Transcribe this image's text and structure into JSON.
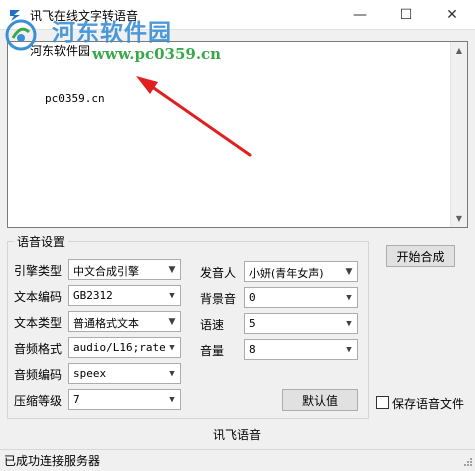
{
  "window": {
    "title": "讯飞在线文字转语音",
    "minimize_glyph": "—",
    "maximize_glyph": "☐",
    "close_glyph": "✕"
  },
  "watermark": {
    "site_name": "河东软件园",
    "url": "www.pc0359.cn"
  },
  "text_input": {
    "lines": [
      "河东软件园",
      "pc0359.cn"
    ]
  },
  "settings": {
    "group_title": "语音设置",
    "engine_label": "引擎类型",
    "engine_value": "中文合成引擎",
    "text_encoding_label": "文本编码",
    "text_encoding_value": "GB2312",
    "text_type_label": "文本类型",
    "text_type_value": "普通格式文本",
    "audio_format_label": "音频格式",
    "audio_format_value": "audio/L16;rate=",
    "audio_codec_label": "音频编码",
    "audio_codec_value": "speex",
    "compression_label": "压缩等级",
    "compression_value": "7",
    "speaker_label": "发音人",
    "speaker_value": "小妍(青年女声)",
    "bg_sound_label": "背景音",
    "bg_sound_value": "0",
    "speed_label": "语速",
    "speed_value": "5",
    "volume_label": "音量",
    "volume_value": "8",
    "default_button": "默认值"
  },
  "actions": {
    "start_button": "开始合成",
    "save_checkbox_label": "保存语音文件",
    "save_checked": false
  },
  "footer": {
    "brand": "讯飞语音"
  },
  "status": {
    "text": "已成功连接服务器"
  },
  "colors": {
    "arrow": "#e02020",
    "watermark_blue": "#3a8fd6",
    "watermark_green": "#3aa84a"
  }
}
